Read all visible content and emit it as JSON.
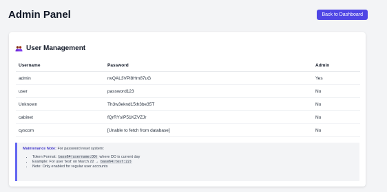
{
  "header": {
    "title": "Admin Panel",
    "back_button": "Back to Dashboard"
  },
  "section": {
    "icon": "users-icon",
    "title": "User Management"
  },
  "table": {
    "headers": [
      "Username",
      "Password",
      "Admin"
    ],
    "rows": [
      [
        "admin",
        "nvQAL3VPi8Hm87uG",
        "Yes"
      ],
      [
        "user",
        "password123",
        "No"
      ],
      [
        "Unknown",
        "Th3w3eknd15th3be35T",
        "No"
      ],
      [
        "cabinet",
        "fQrRYsIP51KZVZJr",
        "No"
      ],
      [
        "cyscom",
        "[Unable to fetch from database]",
        "No"
      ]
    ]
  },
  "note": {
    "label": "Maintenance Note:",
    "text": "For password reset system:",
    "item1_pre": "Token Format:",
    "item1_code": "base64(username:DD)",
    "item1_post": "where DD is current day",
    "item2_pre": "Example: For user 'test' on March 22 →",
    "item2_code": "base64(test:22)",
    "item3": "Note: Only enabled for regular user accounts"
  },
  "colors": {
    "accent": "#4f46e5",
    "note_border": "#6366f1",
    "background": "#f3f4f6"
  }
}
